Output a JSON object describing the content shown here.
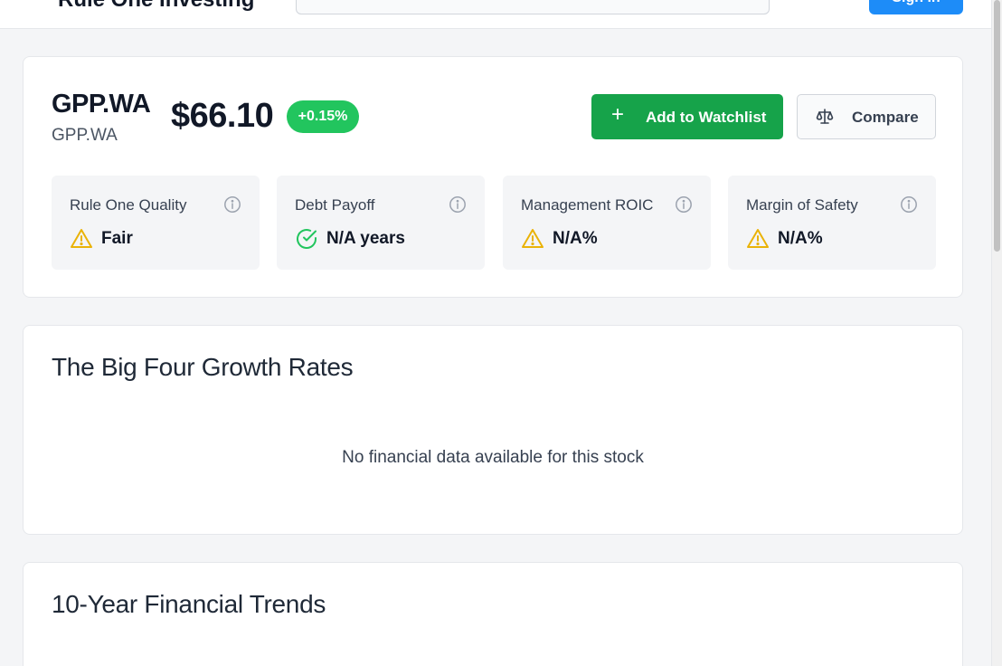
{
  "header": {
    "brand": "Rule One Investing",
    "search_placeholder": "",
    "signin_label": "Sign in"
  },
  "stock": {
    "ticker": "GPP.WA",
    "name": "GPP.WA",
    "price": "$66.10",
    "change": "+0.15%",
    "actions": {
      "watchlist_label": "Add to Watchlist",
      "compare_label": "Compare"
    },
    "metrics": [
      {
        "label": "Rule One Quality",
        "value": "Fair",
        "status": "warning"
      },
      {
        "label": "Debt Payoff",
        "value": "N/A years",
        "status": "ok"
      },
      {
        "label": "Management ROIC",
        "value": "N/A%",
        "status": "warning"
      },
      {
        "label": "Margin of Safety",
        "value": "N/A%",
        "status": "warning"
      }
    ]
  },
  "growth": {
    "title": "The Big Four Growth Rates",
    "empty_message": "No financial data available for this stock"
  },
  "trends": {
    "title": "10-Year Financial Trends"
  },
  "colors": {
    "positive": "#22c55e",
    "watchlist_button": "#16a34a",
    "primary": "#1d8cf8",
    "warning": "#eab308"
  }
}
